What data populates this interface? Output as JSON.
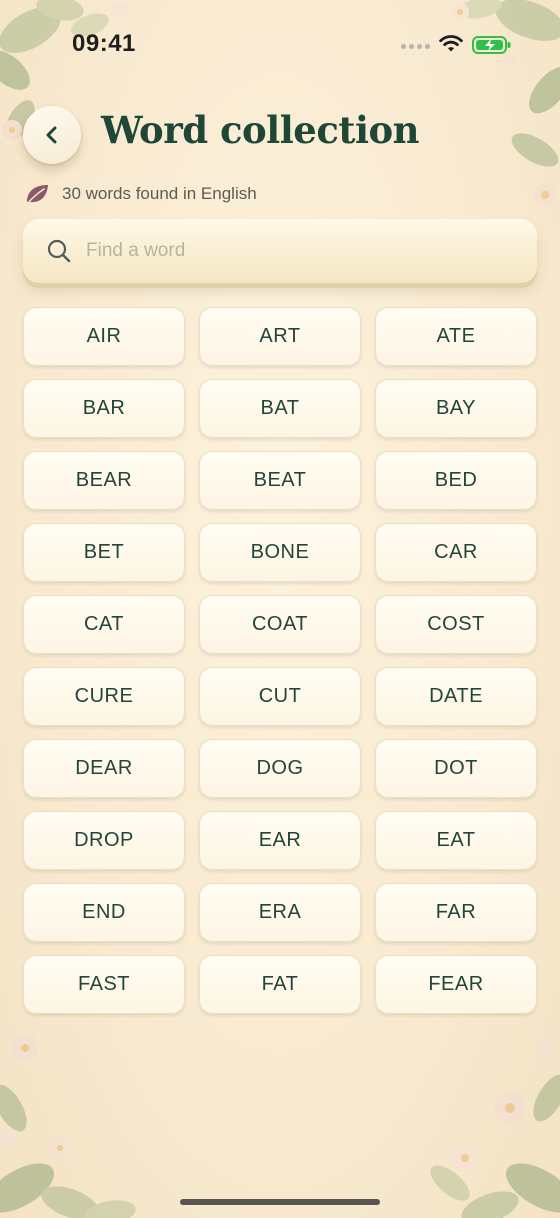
{
  "status_bar": {
    "time": "09:41"
  },
  "header": {
    "title": "Word collection"
  },
  "subtitle": {
    "text": "30 words found in English"
  },
  "search": {
    "placeholder": "Find a word",
    "value": ""
  },
  "words": [
    "AIR",
    "ART",
    "ATE",
    "BAR",
    "BAT",
    "BAY",
    "BEAR",
    "BEAT",
    "BED",
    "BET",
    "BONE",
    "CAR",
    "CAT",
    "COAT",
    "COST",
    "CURE",
    "CUT",
    "DATE",
    "DEAR",
    "DOG",
    "DOT",
    "DROP",
    "EAR",
    "EAT",
    "END",
    "ERA",
    "FAR",
    "FAST",
    "FAT",
    "FEAR"
  ],
  "colors": {
    "title": "#1f4738",
    "word_text": "#24443a",
    "leaf_icon": "#8a5a6a",
    "battery": "#2fbf4a",
    "background": "#f8ead0"
  },
  "icons": {
    "back": "chevron-left-icon",
    "subtitle": "leaf-icon",
    "search": "search-icon"
  }
}
